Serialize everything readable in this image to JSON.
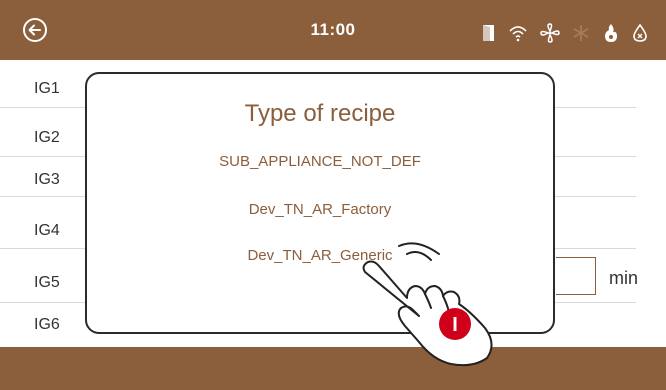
{
  "header": {
    "time": "11:00",
    "status_icons": [
      "door-icon",
      "wifi-icon",
      "fan-icon",
      "snowflake-icon",
      "flame-icon",
      "water-drop-icon"
    ],
    "bar_color": "#8b5e3c"
  },
  "ingredients": [
    {
      "label": "IG1"
    },
    {
      "label": "IG2"
    },
    {
      "label": "IG3"
    },
    {
      "label": "IG4"
    },
    {
      "label": "IG5"
    },
    {
      "label": "IG6"
    }
  ],
  "time_field": {
    "unit": "min"
  },
  "dialog": {
    "title": "Type of recipe",
    "options": [
      {
        "label": "SUB_APPLIANCE_NOT_DEF"
      },
      {
        "label": "Dev_TN_AR_Factory"
      },
      {
        "label": "Dev_TN_AR_Generic"
      }
    ]
  },
  "hint": {
    "badge_text": "I",
    "badge_color": "#d0001a"
  }
}
